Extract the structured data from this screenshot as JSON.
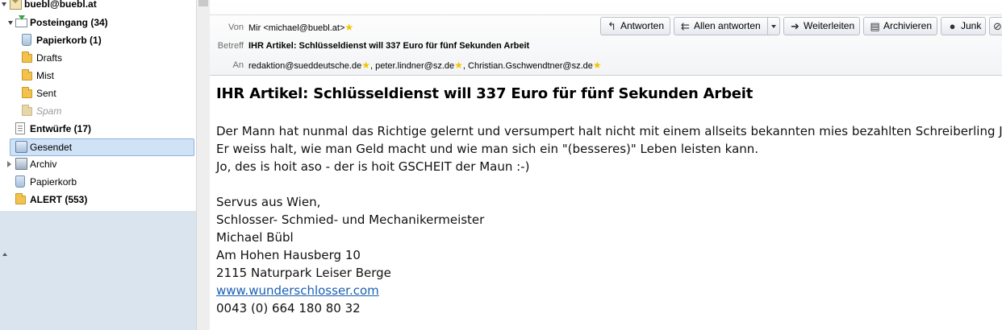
{
  "folders": {
    "account": "buebl@buebl.at",
    "inbox": "Posteingang (34)",
    "inbox_trash": "Papierkorb (1)",
    "drafts": "Drafts",
    "mist": "Mist",
    "sent": "Sent",
    "spam": "Spam",
    "entwuerfe": "Entwürfe (17)",
    "gesendet": "Gesendet",
    "archiv": "Archiv",
    "papierkorb": "Papierkorb",
    "alert": "ALERT (553)"
  },
  "header": {
    "from_label": "Von",
    "from_value": "Mir <michael@buebl.at>",
    "subject_label": "Betreff",
    "subject_value": "IHR Artikel: Schlüsseldienst will 337 Euro für fünf Sekunden Arbeit",
    "to_label": "An",
    "to_1": "redaktion@sueddeutsche.de",
    "to_2": "peter.lindner@sz.de",
    "to_3": "Christian.Gschwendtner@sz.de"
  },
  "toolbar": {
    "reply": "Antworten",
    "reply_all": "Allen antworten",
    "forward": "Weiterleiten",
    "archive": "Archivieren",
    "junk": "Junk"
  },
  "message": {
    "subject": "IHR Artikel: Schlüsseldienst will 337 Euro für fünf Sekunden Arbeit",
    "line1": "Der Mann hat nunmal das Richtige gelernt und versumpert halt nicht mit einem allseits bekannten mies bezahlten Schreiberling Job.",
    "line2": "Er weiss halt, wie man Geld macht und wie man sich ein \"(besseres)\" Leben leisten kann.",
    "line3": "Jo, des is hoit aso - der is hoit GSCHEIT der Maun :-)",
    "sig1": "Servus aus Wien,",
    "sig2": "Schlosser- Schmied- und Mechanikermeister",
    "sig3": "Michael Bübl",
    "sig4": "Am Hohen Hausberg 10",
    "sig5": "2115 Naturpark Leiser Berge",
    "sig_link": "www.wunderschlosser.com",
    "sig6": "0043 (0) 664 180 80 32"
  },
  "icons": {
    "star": "★",
    "reply": "↰",
    "reply_all": "⇇",
    "forward": "➜",
    "archive": "▤",
    "junk": "●",
    "spam_partial": "⊘"
  }
}
